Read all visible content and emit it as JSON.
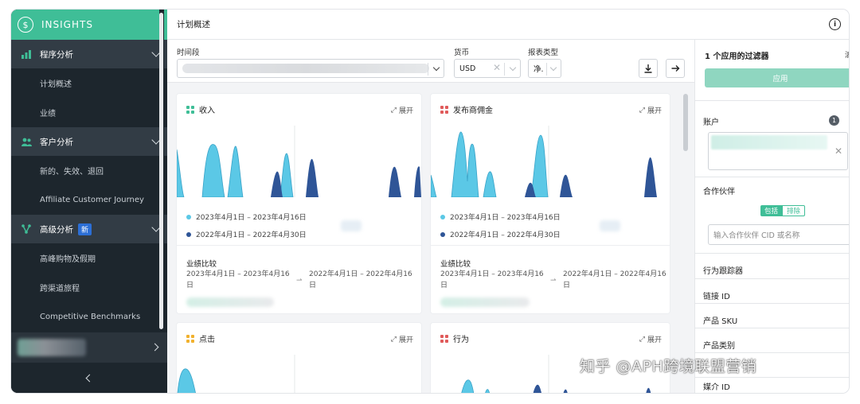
{
  "brand": {
    "name": "INSIGHTS"
  },
  "sidebar": {
    "groups": [
      {
        "label": "程序分析",
        "items": [
          {
            "label": "计划概述"
          },
          {
            "label": "业绩"
          }
        ]
      },
      {
        "label": "客户分析",
        "items": [
          {
            "label": "新的、失效、退回"
          },
          {
            "label": "Affiliate Customer Journey"
          }
        ]
      },
      {
        "label": "高级分析",
        "badge": "新",
        "items": [
          {
            "label": "高峰购物及假期"
          },
          {
            "label": "跨渠道旅程"
          },
          {
            "label": "Competitive Benchmarks"
          }
        ]
      }
    ]
  },
  "header": {
    "title": "计划概述",
    "info_glyph": "i"
  },
  "filters": {
    "period_label": "时间段",
    "currency_label": "货币",
    "currency_value": "USD",
    "report_type_label": "报表类型",
    "report_type_value": "净."
  },
  "cards": [
    {
      "title": "收入",
      "expand": "展开",
      "legend": [
        "2023年4月1日 – 2023年4月16日",
        "2022年4月1日 – 2022年4月30日"
      ],
      "compare_title": "业绩比较",
      "range_a": "2023年4月1日 – 2023年4月16日",
      "range_b": "2022年4月1日 – 2022年4月16日"
    },
    {
      "title": "发布商佣金",
      "expand": "展开",
      "legend": [
        "2023年4月1日 – 2023年4月16日",
        "2022年4月1日 – 2022年4月30日"
      ],
      "compare_title": "业绩比较",
      "range_a": "2023年4月1日 – 2023年4月16日",
      "range_b": "2022年4月1日 – 2022年4月16日"
    },
    {
      "title": "点击",
      "expand": "展开"
    },
    {
      "title": "行为",
      "expand": "展开"
    }
  ],
  "right_panel": {
    "filters_applied": "1 个应用的过滤器",
    "clear": "清",
    "apply": "应用",
    "account_label": "账户",
    "account_count": "1",
    "partner_label": "合作伙伴",
    "include": "包括",
    "exclude": "排除",
    "partner_placeholder": "输入合作伙伴 CID 或名称",
    "fields": [
      "行为跟踪器",
      "链接 ID",
      "产品 SKU",
      "产品类别",
      "",
      "媒介 ID"
    ]
  },
  "watermark": "知乎 @APH跨境联盟营销",
  "colors": {
    "accent": "#3fbe97",
    "series_current": "#5bc8e6",
    "series_previous": "#2f5597",
    "sidebar_bg": "#1d262d"
  }
}
